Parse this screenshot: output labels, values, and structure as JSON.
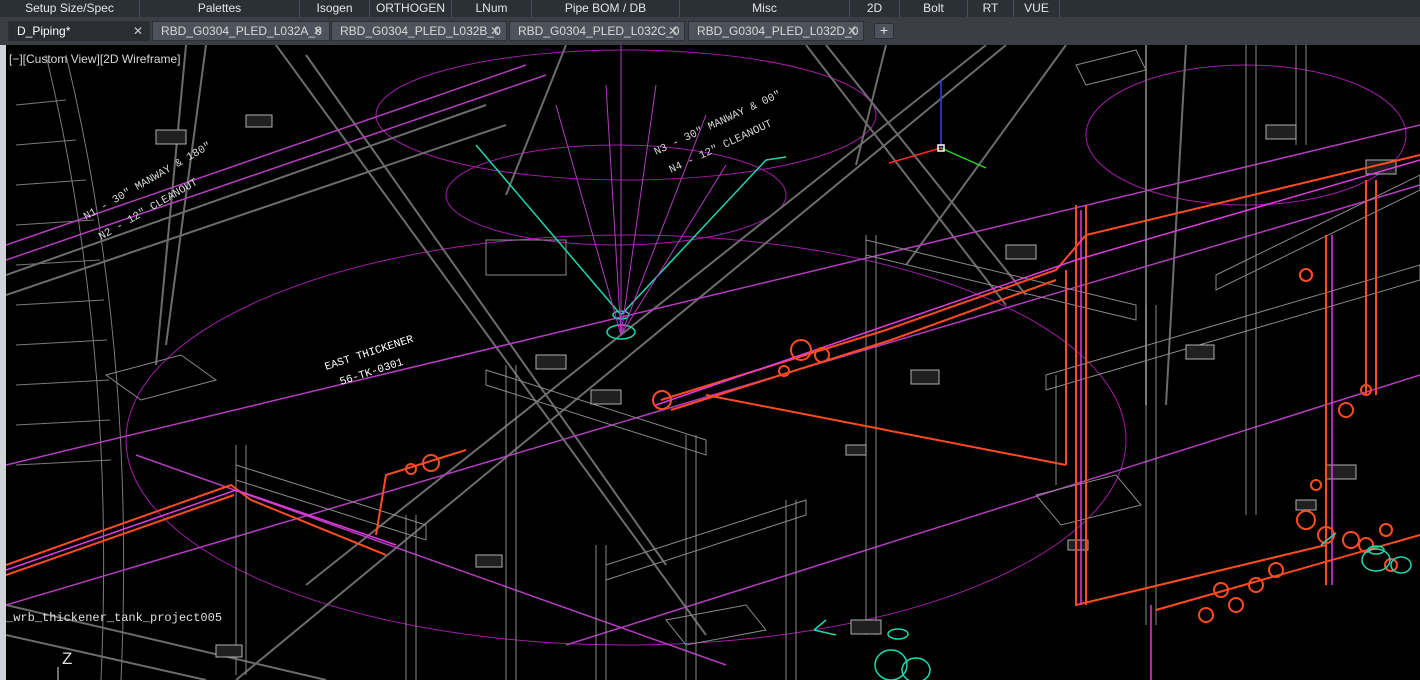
{
  "ribbon": {
    "items": [
      "Setup Size/Spec",
      "Palettes",
      "Isogen",
      "ORTHOGEN",
      "LNum",
      "Pipe BOM / DB",
      "Misc",
      "2D",
      "Bolt",
      "RT",
      "VUE"
    ]
  },
  "tabs": [
    {
      "label": "D_Piping*",
      "active": true
    },
    {
      "label": "RBD_G0304_PLED_L032A_0",
      "active": false
    },
    {
      "label": "RBD_G0304_PLED_L032B_0",
      "active": false
    },
    {
      "label": "RBD_G0304_PLED_L032C_0",
      "active": false
    },
    {
      "label": "RBD_G0304_PLED_L032D_0",
      "active": false
    }
  ],
  "tab_close_icon": "close-icon",
  "new_tab_label": "+",
  "viewport": {
    "view_label": "[−][Custom View][2D Wireframe]",
    "file_label": "_wrb_thickener_tank_project005",
    "ucs_axis_label": "Z"
  },
  "annotations": {
    "note1": "N1 - 30\" MANWAY & 180\"",
    "note2": "N2 - 12\" CLEANOUT",
    "note3": "N3 - 30\" MANWAY & 00\"",
    "note4": "N4 - 12\" CLEANOUT",
    "tag1": "EAST THICKENER",
    "tag2": "56-TK-0301"
  },
  "colors": {
    "ribbon_bg": "#2b2f36",
    "tabbar_bg": "#3b3f45",
    "canvas_bg": "#000000",
    "pipe_red": "#ff4b1f",
    "pipe_magenta": "#e23be2",
    "circle_purple": "#a21ca8",
    "steel_gray": "#8a8a8a",
    "nozzle_teal": "#1fd8b0"
  }
}
